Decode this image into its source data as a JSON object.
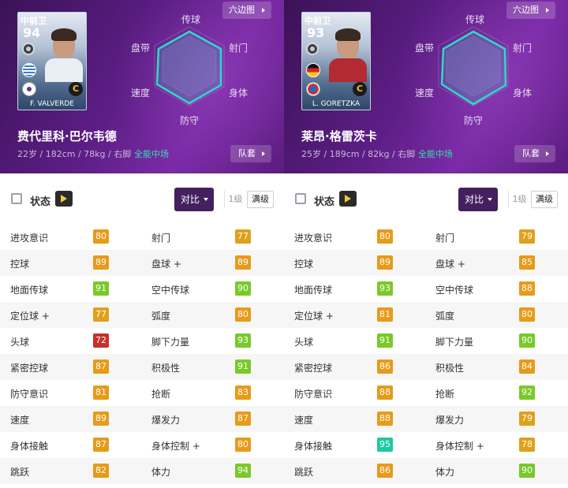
{
  "players": [
    {
      "card": {
        "position": "中前卫",
        "rating": "94",
        "name": "F. VALVERDE",
        "badge": "C"
      },
      "name": "费代里科·巴尔韦德",
      "info": "22岁 / 182cm / 78kg / 右脚",
      "role": "全能中场",
      "hex_button": "六边图",
      "squad_button": "队套",
      "radar_labels": {
        "top": "传球",
        "top_right": "射门",
        "bottom_right": "身体",
        "bottom": "防守",
        "bottom_left": "速度",
        "top_left": "盘带"
      },
      "status_label": "状态",
      "compare_label": "对比",
      "level_label": "1级",
      "max_label": "满级",
      "stats": [
        {
          "l": "进攻意识",
          "lv": "80",
          "r": "射门",
          "rv": "77"
        },
        {
          "l": "控球",
          "lv": "89",
          "r": "盘球 +",
          "rv": "89"
        },
        {
          "l": "地面传球",
          "lv": "91",
          "r": "空中传球",
          "rv": "90"
        },
        {
          "l": "定位球 +",
          "lv": "77",
          "r": "弧度",
          "rv": "80"
        },
        {
          "l": "头球",
          "lv": "72",
          "r": "脚下力量",
          "rv": "93"
        },
        {
          "l": "紧密控球",
          "lv": "87",
          "r": "积极性",
          "rv": "91"
        },
        {
          "l": "防守意识",
          "lv": "81",
          "r": "抢断",
          "rv": "83"
        },
        {
          "l": "速度",
          "lv": "89",
          "r": "爆发力",
          "rv": "87"
        },
        {
          "l": "身体接触",
          "lv": "87",
          "r": "身体控制 +",
          "rv": "80"
        },
        {
          "l": "跳跃",
          "lv": "82",
          "r": "体力",
          "rv": "94"
        }
      ]
    },
    {
      "card": {
        "position": "中前卫",
        "rating": "93",
        "name": "L. GORETZKA",
        "badge": "C"
      },
      "name": "莱昂·格雷茨卡",
      "info": "25岁 / 189cm / 82kg / 右脚",
      "role": "全能中场",
      "hex_button": "六边图",
      "squad_button": "队套",
      "radar_labels": {
        "top": "传球",
        "top_right": "射门",
        "bottom_right": "身体",
        "bottom": "防守",
        "bottom_left": "速度",
        "top_left": "盘带"
      },
      "status_label": "状态",
      "compare_label": "对比",
      "level_label": "1级",
      "max_label": "满级",
      "stats": [
        {
          "l": "进攻意识",
          "lv": "80",
          "r": "射门",
          "rv": "79"
        },
        {
          "l": "控球",
          "lv": "89",
          "r": "盘球 +",
          "rv": "85"
        },
        {
          "l": "地面传球",
          "lv": "93",
          "r": "空中传球",
          "rv": "88"
        },
        {
          "l": "定位球 +",
          "lv": "81",
          "r": "弧度",
          "rv": "80"
        },
        {
          "l": "头球",
          "lv": "91",
          "r": "脚下力量",
          "rv": "90"
        },
        {
          "l": "紧密控球",
          "lv": "86",
          "r": "积极性",
          "rv": "84"
        },
        {
          "l": "防守意识",
          "lv": "88",
          "r": "抢断",
          "rv": "92"
        },
        {
          "l": "速度",
          "lv": "88",
          "r": "爆发力",
          "rv": "79"
        },
        {
          "l": "身体接触",
          "lv": "95",
          "r": "身体控制 +",
          "rv": "78"
        },
        {
          "l": "跳跃",
          "lv": "86",
          "r": "体力",
          "rv": "90"
        }
      ]
    }
  ],
  "colors": {
    "tier_95": "#1ec9a0",
    "tier_90": "#79c92a",
    "tier_80": "#e89a19",
    "tier_75": "#e0a01c",
    "tier_below": "#c8302a"
  }
}
